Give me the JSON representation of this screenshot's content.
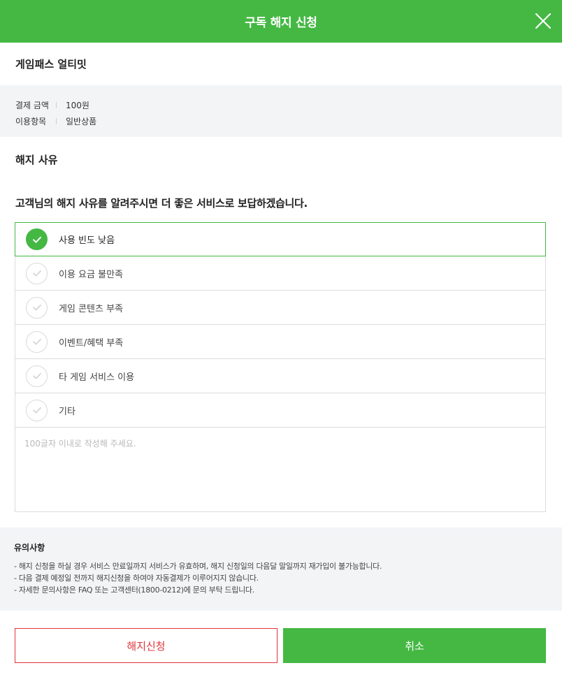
{
  "header": {
    "title": "구독 해지 신청"
  },
  "product": {
    "name": "게임패스 얼티밋"
  },
  "info": {
    "rows": [
      {
        "label": "결제 금액",
        "value": "100원"
      },
      {
        "label": "이용항목",
        "value": "일반상품"
      }
    ]
  },
  "reason": {
    "section_title": "해지 사유",
    "question": "고객님의 해지 사유를 알려주시면 더 좋은 서비스로 보답하겠습니다.",
    "options": [
      {
        "label": "사용 빈도 낮음",
        "selected": true
      },
      {
        "label": "이용 요금 불만족",
        "selected": false
      },
      {
        "label": "게임 콘텐츠 부족",
        "selected": false
      },
      {
        "label": "이벤트/혜택 부족",
        "selected": false
      },
      {
        "label": "타 게임 서비스 이용",
        "selected": false
      },
      {
        "label": "기타",
        "selected": false
      }
    ],
    "textarea_placeholder": "100글자 이내로 작성해 주세요.",
    "textarea_value": ""
  },
  "notice": {
    "title": "유의사항",
    "lines": [
      "- 해지 신청을 하실 경우 서비스 만료일까지 서비스가 유효하며, 해지 신청일의 다음달 말일까지 재가입이 불가능합니다.",
      "- 다음 결제 예정일 전까지 해지신청을 하여야 자동결제가 이루어지지 않습니다.",
      "- 자세한 문의사항은 FAQ 또는 고객센터(1800-0212)에 문의 부탁 드립니다."
    ]
  },
  "buttons": {
    "terminate_label": "해지신청",
    "cancel_label": "취소"
  },
  "colors": {
    "accent": "#44b843",
    "danger": "#e0343b"
  },
  "icons": {
    "close": "close-icon",
    "check": "check-icon"
  }
}
